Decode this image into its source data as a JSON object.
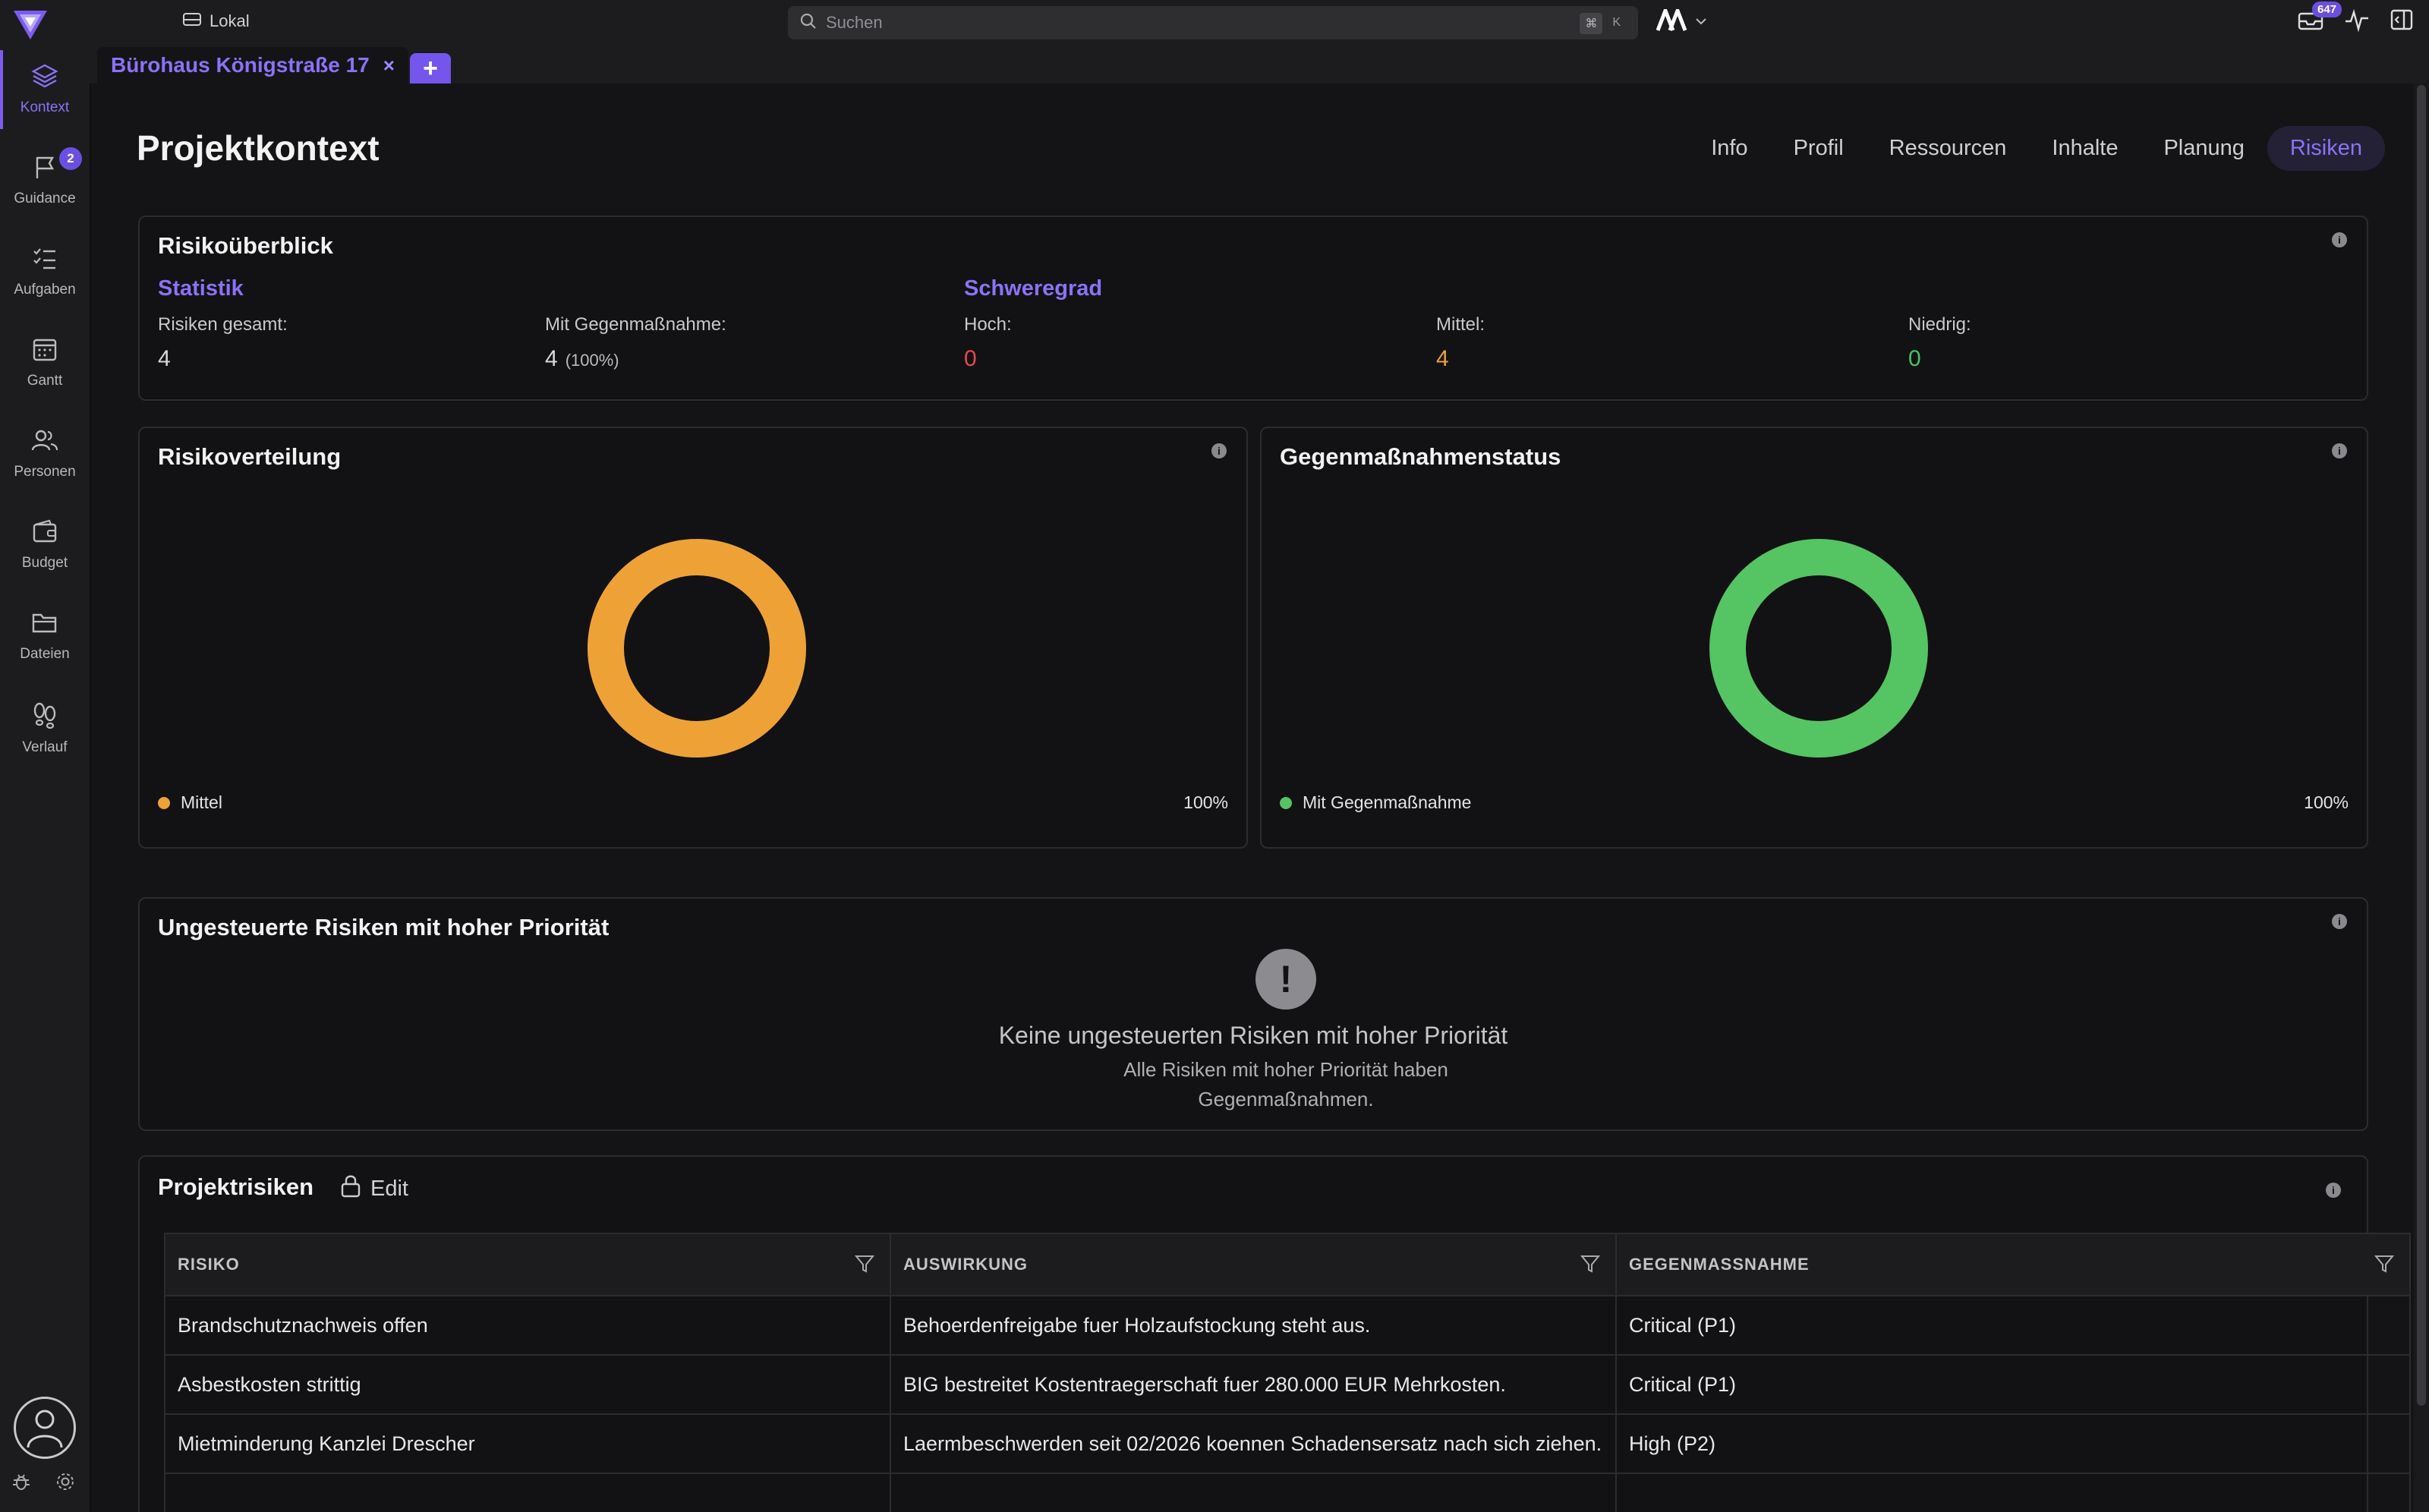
{
  "topbar": {
    "env_label": "Lokal",
    "search_placeholder": "Suchen",
    "shortcut_key1": "⌘",
    "shortcut_key2": "K",
    "inbox_count": "647"
  },
  "sidebar": {
    "items": [
      {
        "label": "Kontext",
        "icon": "layers-icon"
      },
      {
        "label": "Guidance",
        "icon": "flag-icon",
        "badge": "2"
      },
      {
        "label": "Aufgaben",
        "icon": "checklist-icon"
      },
      {
        "label": "Gantt",
        "icon": "calendar-icon"
      },
      {
        "label": "Personen",
        "icon": "people-icon"
      },
      {
        "label": "Budget",
        "icon": "wallet-icon"
      },
      {
        "label": "Dateien",
        "icon": "folder-icon"
      },
      {
        "label": "Verlauf",
        "icon": "footsteps-icon"
      }
    ]
  },
  "project_tab": {
    "label": "Bürohaus Königstraße 17",
    "close": "×",
    "add": "+"
  },
  "page": {
    "title": "Projektkontext",
    "tabs": [
      "Info",
      "Profil",
      "Ressourcen",
      "Inhalte",
      "Planung",
      "Risiken"
    ],
    "active_tab": "Risiken"
  },
  "overview": {
    "title": "Risikoüberblick",
    "statistik_heading": "Statistik",
    "schweregrad_heading": "Schweregrad",
    "total_label": "Risiken gesamt:",
    "total_value": "4",
    "mitigated_label": "Mit Gegenmaßnahme:",
    "mitigated_value": "4",
    "mitigated_pct": "(100%)",
    "hoch_label": "Hoch:",
    "hoch_value": "0",
    "mittel_label": "Mittel:",
    "mittel_value": "4",
    "niedrig_label": "Niedrig:",
    "niedrig_value": "0",
    "colors": {
      "hoch": "#e5484d",
      "mittel": "#eea236",
      "niedrig": "#46c160"
    }
  },
  "distribution": {
    "title": "Risikoverteilung",
    "legend_label": "Mittel",
    "legend_pct": "100%",
    "color": "#eea236"
  },
  "mitigation_status": {
    "title": "Gegenmaßnahmenstatus",
    "legend_label": "Mit Gegenmaßnahme",
    "legend_pct": "100%",
    "color": "#55c463"
  },
  "unmanaged": {
    "title": "Ungesteuerte Risiken mit hoher Priorität",
    "empty_title": "Keine ungesteuerten Risiken mit hoher Priorität",
    "empty_line1": "Alle Risiken mit hoher Priorität haben",
    "empty_line2": "Gegenmaßnahmen."
  },
  "project_risks": {
    "title": "Projektrisiken",
    "edit_label": "Edit",
    "columns": [
      "RISIKO",
      "AUSWIRKUNG",
      "GEGENMASSNAHME"
    ],
    "rows": [
      [
        "Brandschutznachweis offen",
        "Behoerdenfreigabe fuer Holzaufstockung steht aus.",
        "Critical (P1)"
      ],
      [
        "Asbestkosten strittig",
        "BIG bestreitet Kostentraegerschaft fuer 280.000 EUR Mehrkosten.",
        "Critical (P1)"
      ],
      [
        "Mietminderung Kanzlei Drescher",
        "Laermbeschwerden seit 02/2026 koennen Schadensersatz nach sich ziehen.",
        "High (P2)"
      ]
    ]
  }
}
